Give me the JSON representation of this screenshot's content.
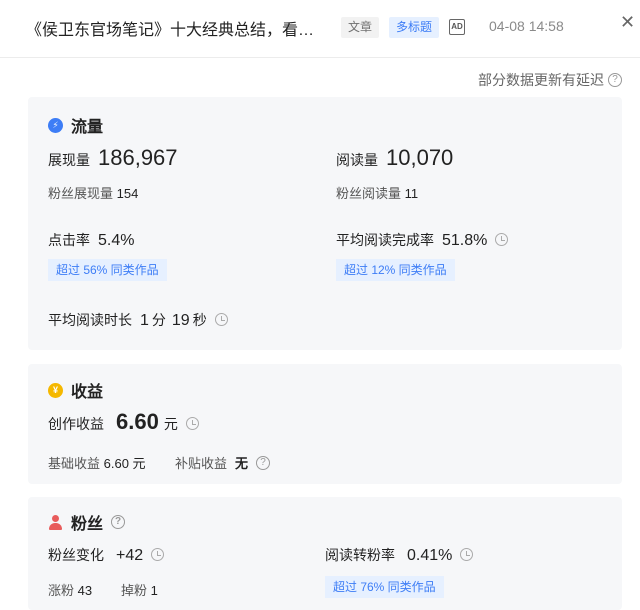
{
  "header": {
    "title": "《侯卫东官场笔记》十大经典总结，看…",
    "tag_article": "文章",
    "tag_multi_title": "多标题",
    "ad_badge": "AD",
    "time": "04-08 14:58",
    "close": "✕"
  },
  "note": "部分数据更新有延迟",
  "traffic": {
    "title": "流量",
    "impressions_label": "展现量",
    "impressions_value": "186,967",
    "fan_impressions_label": "粉丝展现量",
    "fan_impressions_value": "154",
    "reads_label": "阅读量",
    "reads_value": "10,070",
    "fan_reads_label": "粉丝阅读量",
    "fan_reads_value": "11",
    "ctr_label": "点击率",
    "ctr_value": "5.4%",
    "ctr_badge": "超过 56% 同类作品",
    "completion_label": "平均阅读完成率",
    "completion_value": "51.8%",
    "completion_badge": "超过 12% 同类作品",
    "avg_time_label": "平均阅读时长",
    "avg_time_min": "1",
    "avg_time_min_unit": "分",
    "avg_time_sec": "19",
    "avg_time_sec_unit": "秒"
  },
  "revenue": {
    "title": "收益",
    "creation_label": "创作收益",
    "creation_value": "6.60",
    "creation_unit": "元",
    "base_label": "基础收益",
    "base_value": "6.60 元",
    "subsidy_label": "补贴收益",
    "subsidy_value": "无"
  },
  "fans": {
    "title": "粉丝",
    "change_label": "粉丝变化",
    "change_value": "+42",
    "gain_label": "涨粉",
    "gain_value": "43",
    "loss_label": "掉粉",
    "loss_value": "1",
    "conversion_label": "阅读转粉率",
    "conversion_value": "0.41%",
    "conversion_badge": "超过 76% 同类作品"
  },
  "colors": {
    "accent": "#3d7df6",
    "badge_bg": "#e6f0ff",
    "card_bg": "#f6f7f9",
    "coin": "#f5b800",
    "person": "#e85c5c"
  }
}
